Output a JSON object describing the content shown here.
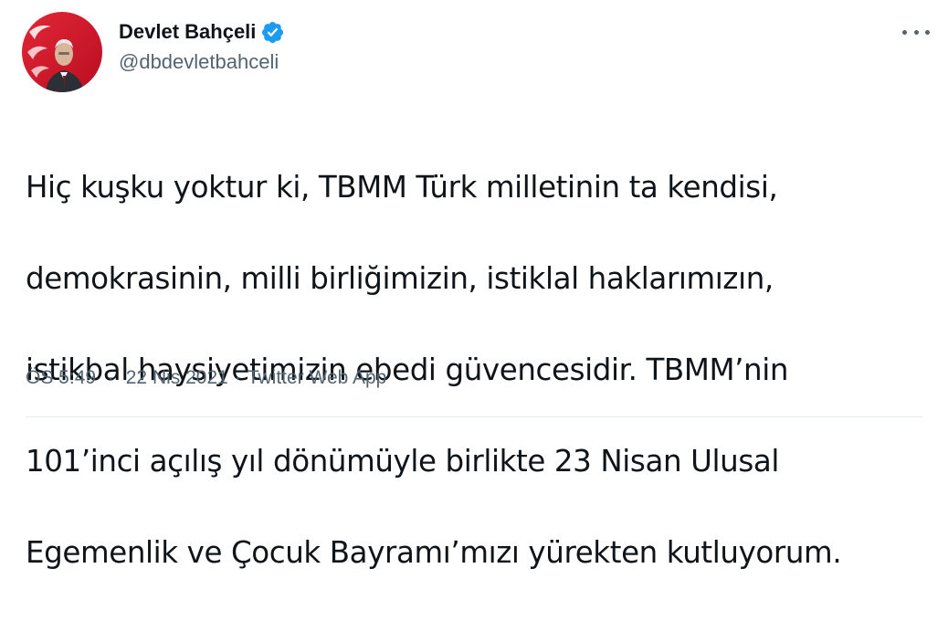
{
  "author": {
    "display_name": "Devlet Bahçeli",
    "handle": "@dbdevletbahceli",
    "verified": true
  },
  "tweet": {
    "text_lines": [
      "Hiç kuşku yoktur ki, TBMM Türk milletinin ta kendisi,",
      "demokrasinin, milli birliğimizin, istiklal haklarımızın,",
      "istikbal haysiyetimizin ebedi güvencesidir. TBMM’nin",
      "101’inci açılış yıl dönümüyle birlikte 23 Nisan Ulusal",
      "Egemenlik ve Çocuk Bayramı’mızı yürekten kutluyorum."
    ],
    "time": "ÖS 5:49",
    "date": "22 Nis 2021",
    "source": "Twitter Web App",
    "separator": "·"
  },
  "icons": {
    "verified": "verified-badge-icon",
    "more": "more-options-icon"
  },
  "colors": {
    "verified": "#1d9bf0",
    "secondary_text": "#536471",
    "primary_text": "#0f1419",
    "avatar_flag": "#d6152a"
  }
}
